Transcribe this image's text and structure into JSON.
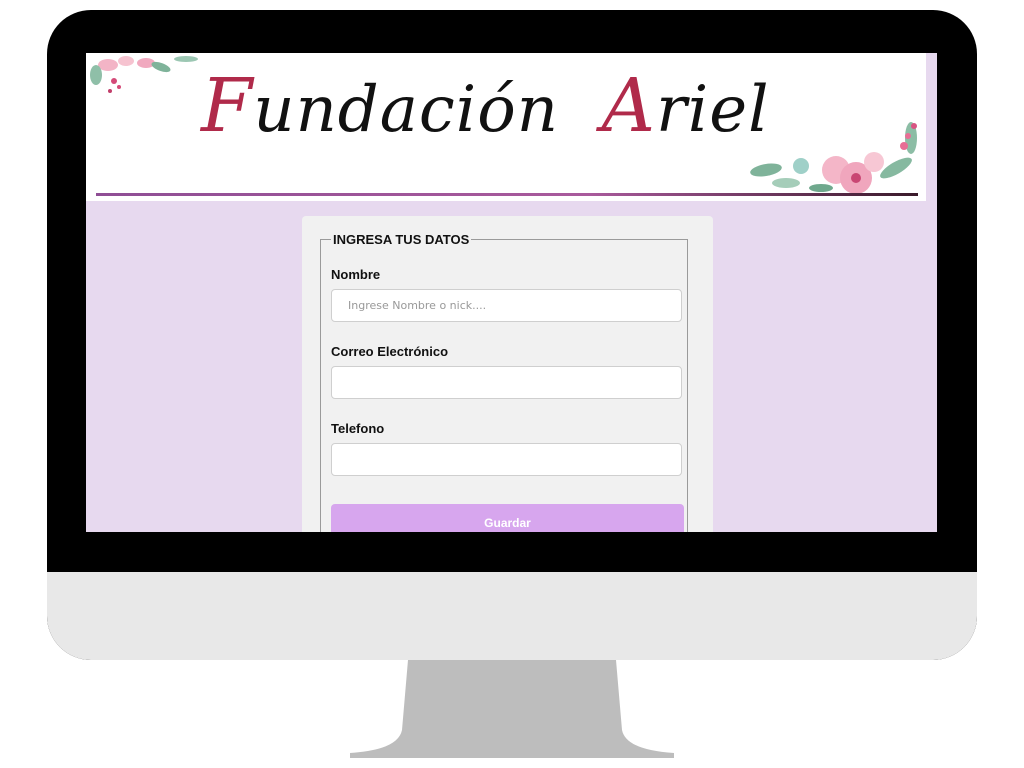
{
  "banner": {
    "title_first_cap": "F",
    "title_first_rest": "undación",
    "title_second_cap": "A",
    "title_second_rest": "riel"
  },
  "form": {
    "legend": "INGRESA TUS DATOS",
    "name_label": "Nombre",
    "name_placeholder": "Ingrese Nombre o nick....",
    "email_label": "Correo Electrónico",
    "email_placeholder": "",
    "phone_label": "Telefono",
    "phone_placeholder": "",
    "submit_label": "Guardar"
  },
  "colors": {
    "page_background": "#e7d9ef",
    "button": "#d7a6ee",
    "accent_title": "#b02a4a",
    "monitor_frame": "#000000",
    "monitor_chin": "#e8e8e8",
    "stand": "#bdbdbd"
  },
  "icons": [
    "floral-decoration-left",
    "floral-decoration-right"
  ]
}
